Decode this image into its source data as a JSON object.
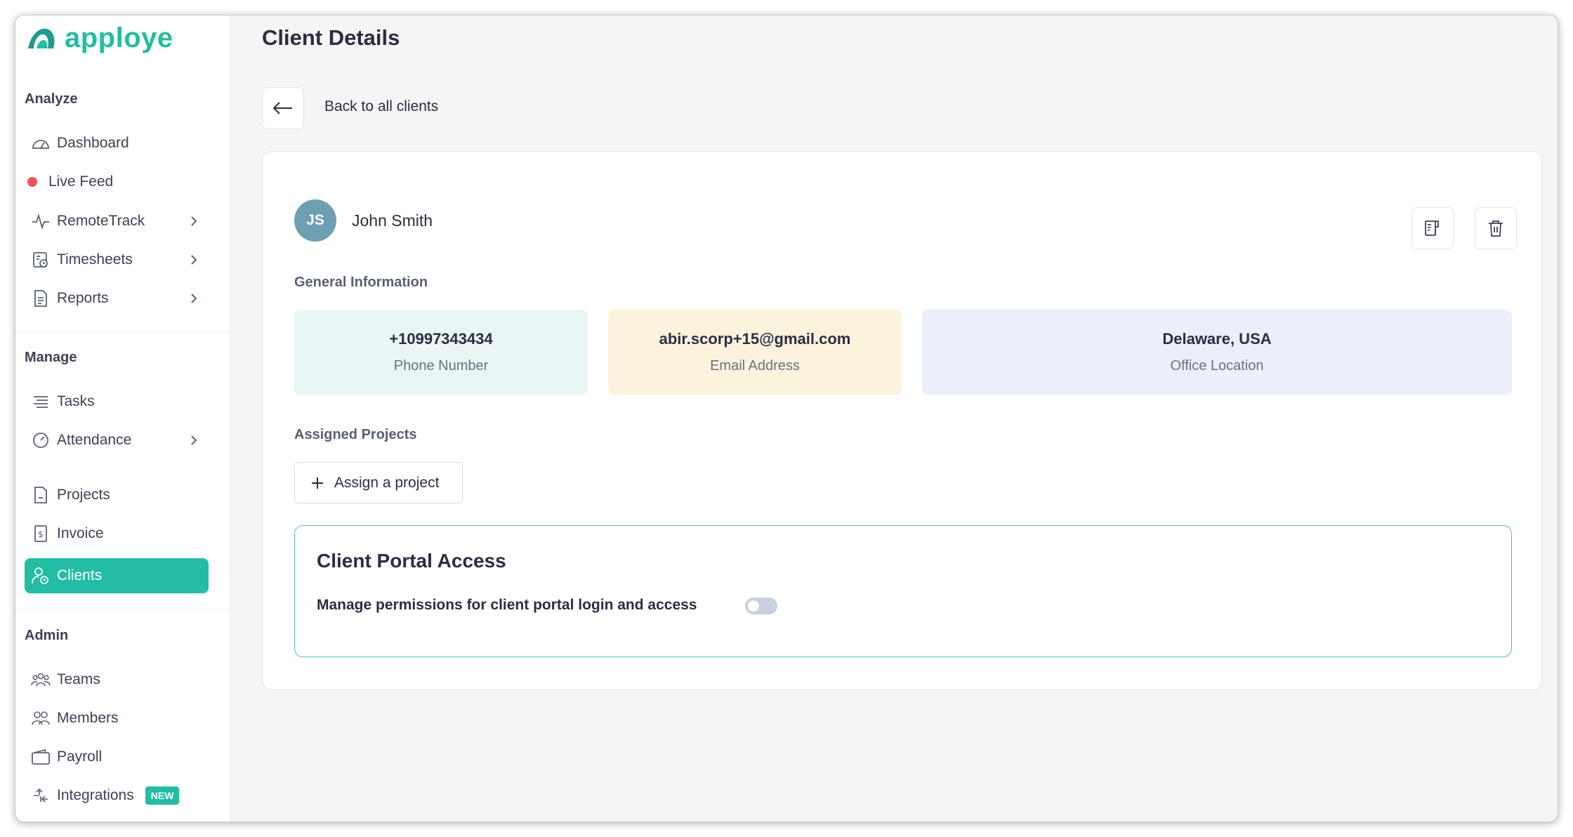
{
  "app": {
    "name": "apploye"
  },
  "sidebar": {
    "sections": {
      "analyze": "Analyze",
      "manage": "Manage",
      "admin": "Admin"
    },
    "items": {
      "dashboard": {
        "label": "Dashboard",
        "icon": "speedometer-icon"
      },
      "live_feed": {
        "label": "Live Feed",
        "icon": "live-dot-icon"
      },
      "remote_track": {
        "label": "RemoteTrack",
        "icon": "activity-icon"
      },
      "timesheets": {
        "label": "Timesheets",
        "icon": "timesheet-icon"
      },
      "reports": {
        "label": "Reports",
        "icon": "report-icon"
      },
      "tasks": {
        "label": "Tasks",
        "icon": "list-icon"
      },
      "attendance": {
        "label": "Attendance",
        "icon": "gauge-icon"
      },
      "projects": {
        "label": "Projects",
        "icon": "file-icon"
      },
      "invoice": {
        "label": "Invoice",
        "icon": "invoice-icon"
      },
      "clients": {
        "label": "Clients",
        "icon": "client-icon",
        "active": true
      },
      "teams": {
        "label": "Teams",
        "icon": "team-icon"
      },
      "members": {
        "label": "Members",
        "icon": "members-icon"
      },
      "payroll": {
        "label": "Payroll",
        "icon": "wallet-icon"
      },
      "integrations": {
        "label": "Integrations",
        "icon": "plug-icon",
        "badge": "NEW"
      }
    }
  },
  "page": {
    "title": "Client Details",
    "back_label": "Back to all clients"
  },
  "client": {
    "initials": "JS",
    "name": "John Smith",
    "general_info_heading": "General Information",
    "phone": {
      "value": "+10997343434",
      "caption": "Phone Number"
    },
    "email": {
      "value": "abir.scorp+15@gmail.com",
      "caption": "Email Address"
    },
    "location": {
      "value": "Delaware, USA",
      "caption": "Office Location"
    },
    "assigned_projects_heading": "Assigned Projects",
    "assign_button_label": "Assign a project"
  },
  "portal": {
    "title": "Client Portal Access",
    "description": "Manage permissions for client portal login and access",
    "enabled": false
  },
  "colors": {
    "accent": "#23bda4",
    "phone_tile": "#eaf6f6",
    "email_tile": "#fcf3dc",
    "location_tile": "#ebeffa",
    "avatar": "#6f9fb2"
  }
}
